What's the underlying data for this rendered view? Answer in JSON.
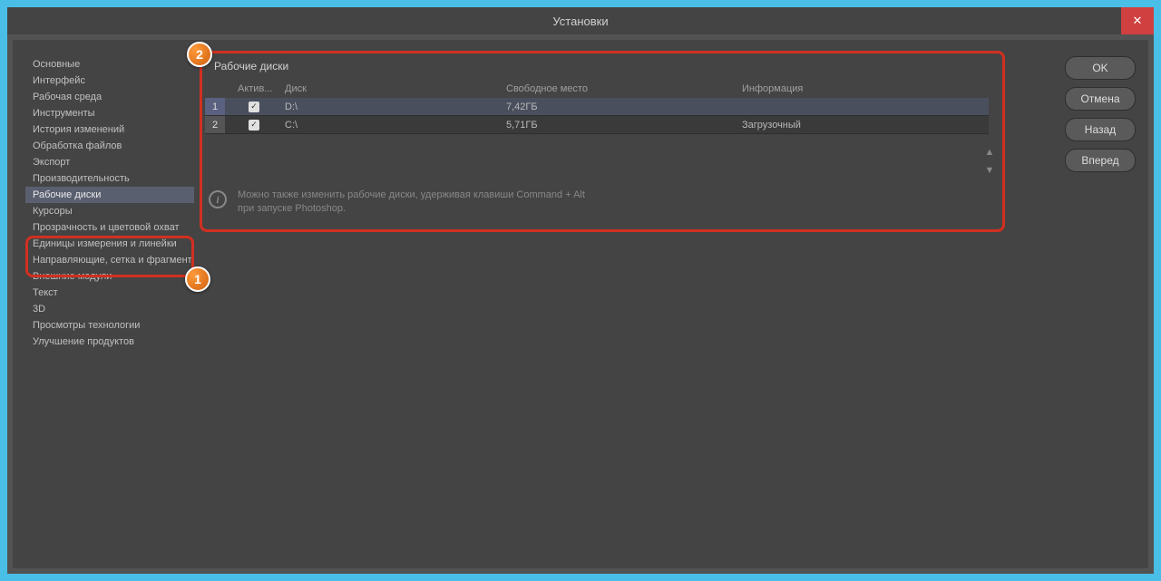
{
  "window": {
    "title": "Установки",
    "close": "✕"
  },
  "sidebar": {
    "items": [
      "Основные",
      "Интерфейс",
      "Рабочая среда",
      "Инструменты",
      "История изменений",
      "Обработка файлов",
      "Экспорт",
      "Производительность",
      "Рабочие диски",
      "Курсоры",
      "Прозрачность и цветовой охват",
      "Единицы измерения и линейки",
      "Направляющие, сетка и фрагменты",
      "Внешние модули",
      "Текст",
      "3D",
      "Просмотры технологии",
      "Улучшение продуктов"
    ],
    "selectedIndex": 8
  },
  "panel": {
    "title": "Рабочие диски",
    "headers": {
      "active": "Актив...",
      "drive": "Диск",
      "free": "Свободное место",
      "info": "Информация"
    },
    "rows": [
      {
        "num": "1",
        "active": true,
        "drive": "D:\\",
        "free": "7,42ГБ",
        "info": ""
      },
      {
        "num": "2",
        "active": true,
        "drive": "C:\\",
        "free": "5,71ГБ",
        "info": "Загрузочный"
      }
    ]
  },
  "note": {
    "line1": "Можно также изменить рабочие диски, удерживая клавиши Command + Alt",
    "line2": "при запуске Photoshop."
  },
  "buttons": {
    "ok": "OK",
    "cancel": "Отмена",
    "back": "Назад",
    "forward": "Вперед"
  },
  "callouts": {
    "one": "1",
    "two": "2"
  }
}
